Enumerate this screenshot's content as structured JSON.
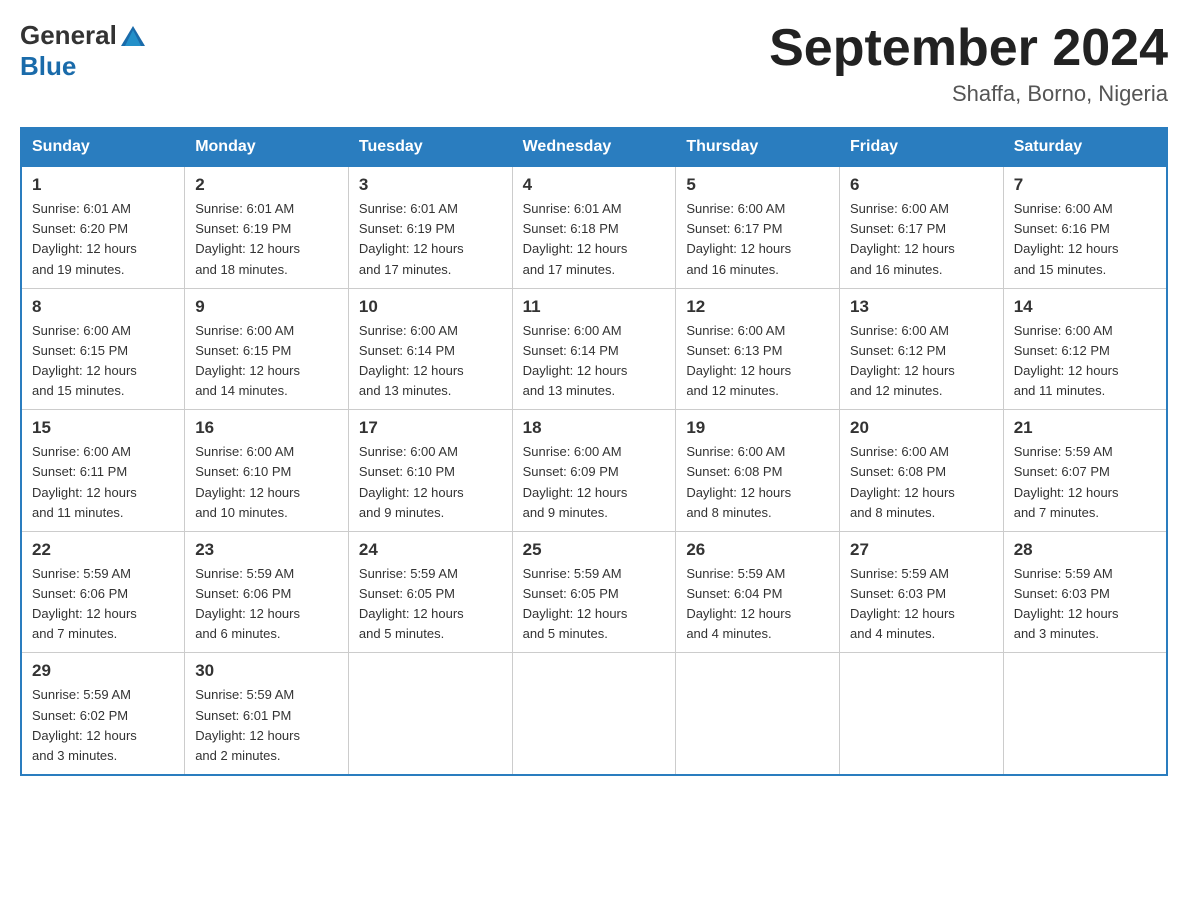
{
  "header": {
    "logo_general": "General",
    "logo_blue": "Blue",
    "calendar_title": "September 2024",
    "calendar_subtitle": "Shaffa, Borno, Nigeria"
  },
  "days_of_week": [
    "Sunday",
    "Monday",
    "Tuesday",
    "Wednesday",
    "Thursday",
    "Friday",
    "Saturday"
  ],
  "weeks": [
    [
      {
        "day": "1",
        "sunrise": "6:01 AM",
        "sunset": "6:20 PM",
        "daylight": "12 hours and 19 minutes."
      },
      {
        "day": "2",
        "sunrise": "6:01 AM",
        "sunset": "6:19 PM",
        "daylight": "12 hours and 18 minutes."
      },
      {
        "day": "3",
        "sunrise": "6:01 AM",
        "sunset": "6:19 PM",
        "daylight": "12 hours and 17 minutes."
      },
      {
        "day": "4",
        "sunrise": "6:01 AM",
        "sunset": "6:18 PM",
        "daylight": "12 hours and 17 minutes."
      },
      {
        "day": "5",
        "sunrise": "6:00 AM",
        "sunset": "6:17 PM",
        "daylight": "12 hours and 16 minutes."
      },
      {
        "day": "6",
        "sunrise": "6:00 AM",
        "sunset": "6:17 PM",
        "daylight": "12 hours and 16 minutes."
      },
      {
        "day": "7",
        "sunrise": "6:00 AM",
        "sunset": "6:16 PM",
        "daylight": "12 hours and 15 minutes."
      }
    ],
    [
      {
        "day": "8",
        "sunrise": "6:00 AM",
        "sunset": "6:15 PM",
        "daylight": "12 hours and 15 minutes."
      },
      {
        "day": "9",
        "sunrise": "6:00 AM",
        "sunset": "6:15 PM",
        "daylight": "12 hours and 14 minutes."
      },
      {
        "day": "10",
        "sunrise": "6:00 AM",
        "sunset": "6:14 PM",
        "daylight": "12 hours and 13 minutes."
      },
      {
        "day": "11",
        "sunrise": "6:00 AM",
        "sunset": "6:14 PM",
        "daylight": "12 hours and 13 minutes."
      },
      {
        "day": "12",
        "sunrise": "6:00 AM",
        "sunset": "6:13 PM",
        "daylight": "12 hours and 12 minutes."
      },
      {
        "day": "13",
        "sunrise": "6:00 AM",
        "sunset": "6:12 PM",
        "daylight": "12 hours and 12 minutes."
      },
      {
        "day": "14",
        "sunrise": "6:00 AM",
        "sunset": "6:12 PM",
        "daylight": "12 hours and 11 minutes."
      }
    ],
    [
      {
        "day": "15",
        "sunrise": "6:00 AM",
        "sunset": "6:11 PM",
        "daylight": "12 hours and 11 minutes."
      },
      {
        "day": "16",
        "sunrise": "6:00 AM",
        "sunset": "6:10 PM",
        "daylight": "12 hours and 10 minutes."
      },
      {
        "day": "17",
        "sunrise": "6:00 AM",
        "sunset": "6:10 PM",
        "daylight": "12 hours and 9 minutes."
      },
      {
        "day": "18",
        "sunrise": "6:00 AM",
        "sunset": "6:09 PM",
        "daylight": "12 hours and 9 minutes."
      },
      {
        "day": "19",
        "sunrise": "6:00 AM",
        "sunset": "6:08 PM",
        "daylight": "12 hours and 8 minutes."
      },
      {
        "day": "20",
        "sunrise": "6:00 AM",
        "sunset": "6:08 PM",
        "daylight": "12 hours and 8 minutes."
      },
      {
        "day": "21",
        "sunrise": "5:59 AM",
        "sunset": "6:07 PM",
        "daylight": "12 hours and 7 minutes."
      }
    ],
    [
      {
        "day": "22",
        "sunrise": "5:59 AM",
        "sunset": "6:06 PM",
        "daylight": "12 hours and 7 minutes."
      },
      {
        "day": "23",
        "sunrise": "5:59 AM",
        "sunset": "6:06 PM",
        "daylight": "12 hours and 6 minutes."
      },
      {
        "day": "24",
        "sunrise": "5:59 AM",
        "sunset": "6:05 PM",
        "daylight": "12 hours and 5 minutes."
      },
      {
        "day": "25",
        "sunrise": "5:59 AM",
        "sunset": "6:05 PM",
        "daylight": "12 hours and 5 minutes."
      },
      {
        "day": "26",
        "sunrise": "5:59 AM",
        "sunset": "6:04 PM",
        "daylight": "12 hours and 4 minutes."
      },
      {
        "day": "27",
        "sunrise": "5:59 AM",
        "sunset": "6:03 PM",
        "daylight": "12 hours and 4 minutes."
      },
      {
        "day": "28",
        "sunrise": "5:59 AM",
        "sunset": "6:03 PM",
        "daylight": "12 hours and 3 minutes."
      }
    ],
    [
      {
        "day": "29",
        "sunrise": "5:59 AM",
        "sunset": "6:02 PM",
        "daylight": "12 hours and 3 minutes."
      },
      {
        "day": "30",
        "sunrise": "5:59 AM",
        "sunset": "6:01 PM",
        "daylight": "12 hours and 2 minutes."
      },
      null,
      null,
      null,
      null,
      null
    ]
  ],
  "labels": {
    "sunrise": "Sunrise:",
    "sunset": "Sunset:",
    "daylight": "Daylight:"
  }
}
